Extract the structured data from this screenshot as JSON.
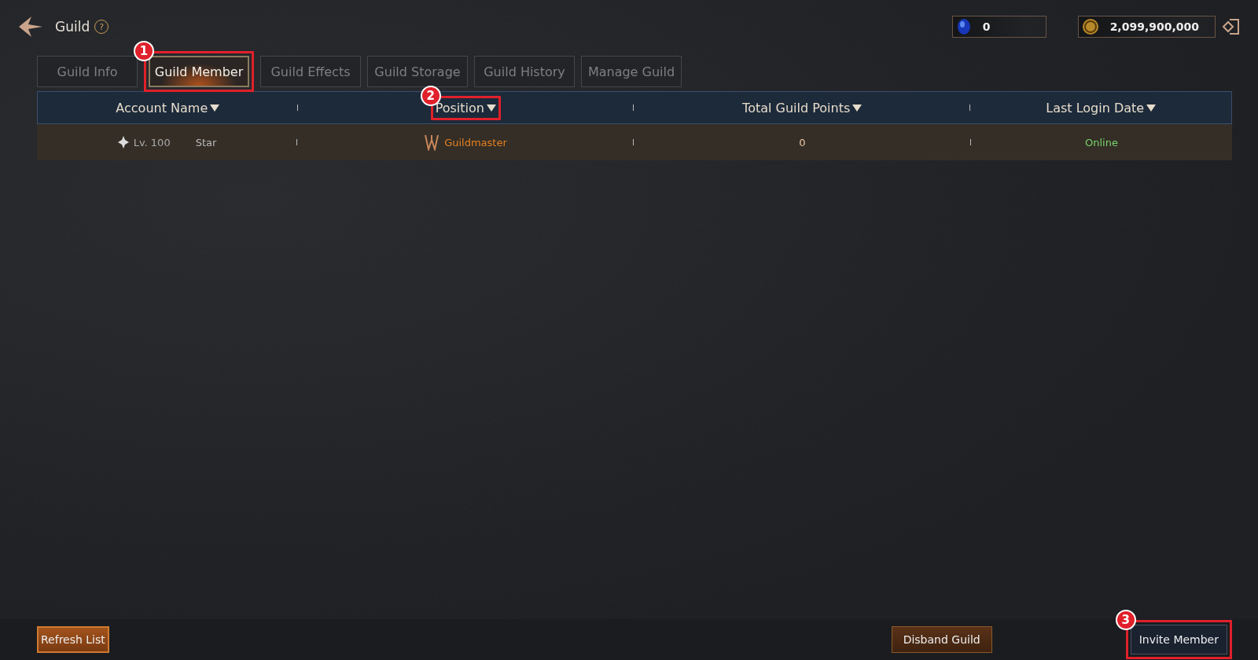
{
  "header": {
    "title": "Guild",
    "help": "?"
  },
  "currencies": [
    {
      "kind": "gem",
      "value": "0"
    },
    {
      "kind": "coin",
      "value": "2,099,900,000"
    }
  ],
  "tabs": [
    {
      "label": "Guild Info",
      "selected": false
    },
    {
      "label": "Guild Member",
      "selected": true,
      "annotation": "1"
    },
    {
      "label": "Guild Effects",
      "selected": false
    },
    {
      "label": "Guild Storage",
      "selected": false
    },
    {
      "label": "Guild History",
      "selected": false
    },
    {
      "label": "Manage Guild",
      "selected": false
    }
  ],
  "table": {
    "columns": [
      {
        "label": "Account Name"
      },
      {
        "label": "Position",
        "annotation": "2"
      },
      {
        "label": "Total Guild Points"
      },
      {
        "label": "Last Login Date"
      }
    ],
    "rows": [
      {
        "level": "Lv. 100",
        "name": "Star",
        "position": "Guildmaster",
        "points": "0",
        "last_login": "Online"
      }
    ]
  },
  "footer": {
    "buttons": [
      {
        "label": "Refresh List",
        "kind": "orange"
      },
      {
        "label": "Disband Guild",
        "kind": "brown"
      },
      {
        "label": "Invite Member",
        "kind": "dark",
        "annotation": "3"
      }
    ]
  }
}
